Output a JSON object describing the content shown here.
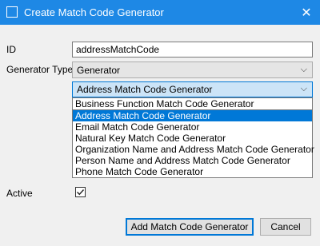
{
  "window": {
    "title": "Create Match Code Generator",
    "close_glyph": "✕"
  },
  "form": {
    "id_label": "ID",
    "id_value": "addressMatchCode",
    "generator_type_label": "Generator Type",
    "generator_type_value": "Generator",
    "generator_value": "Address Match Code Generator",
    "generator_options": [
      "Business Function Match Code Generator",
      "Address Match Code Generator",
      "Email Match Code Generator",
      "Natural Key Match Code Generator",
      "Organization Name and Address Match Code Generator",
      "Person Name and Address Match Code Generator",
      "Phone Match Code Generator"
    ],
    "selected_option_index": 1,
    "active_label": "Active",
    "active_checked": true
  },
  "buttons": {
    "add_label": "Add Match Code Generator",
    "cancel_label": "Cancel"
  },
  "colors": {
    "titlebar": "#1e88e5",
    "selection": "#0078d7"
  }
}
